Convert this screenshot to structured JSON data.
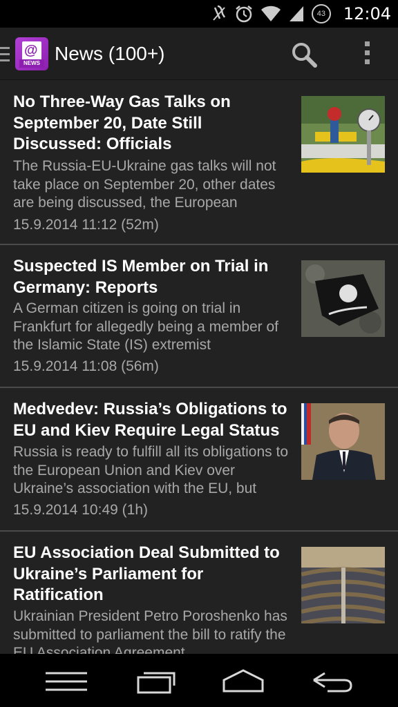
{
  "status_bar": {
    "time": "12:04",
    "battery": "43",
    "icons": [
      "mute-icon",
      "alarm-icon",
      "wifi-icon",
      "signal-icon",
      "battery-icon"
    ]
  },
  "action_bar": {
    "title": "News (100+)",
    "logo_text": "NEWS",
    "logo_symbol": "@",
    "icons": [
      "drawer-icon",
      "search-icon",
      "overflow-menu-icon"
    ]
  },
  "news": [
    {
      "headline": "No Three-Way Gas Talks on September 20, Date Still Discussed: Officials",
      "summary": "The Russia-EU-Ukraine gas talks will not take place on September 20, other dates are being discussed, the European",
      "date": "15.9.2014 11:12 (52m)"
    },
    {
      "headline": "Suspected IS Member on Trial in Germany: Reports",
      "summary": "A German citizen is going on trial in Frankfurt for allegedly being a member of the Islamic State (IS) extremist",
      "date": "15.9.2014 11:08 (56m)"
    },
    {
      "headline": "Medvedev: Russia’s Obligations to EU and Kiev Require Legal Status",
      "summary": "Russia is ready to fulfill all its obligations to the European Union and Kiev over Ukraine’s association with the EU, but",
      "date": "15.9.2014 10:49 (1h)"
    },
    {
      "headline": "EU Association Deal Submitted to Ukraine’s Parliament for Ratification",
      "summary": "Ukrainian President Petro Poroshenko has submitted to parliament the bill to ratify the EU Association Agreement",
      "date": ""
    }
  ],
  "nav_bar": {
    "icons": [
      "menu-icon",
      "recent-apps-icon",
      "home-icon",
      "back-icon"
    ]
  }
}
